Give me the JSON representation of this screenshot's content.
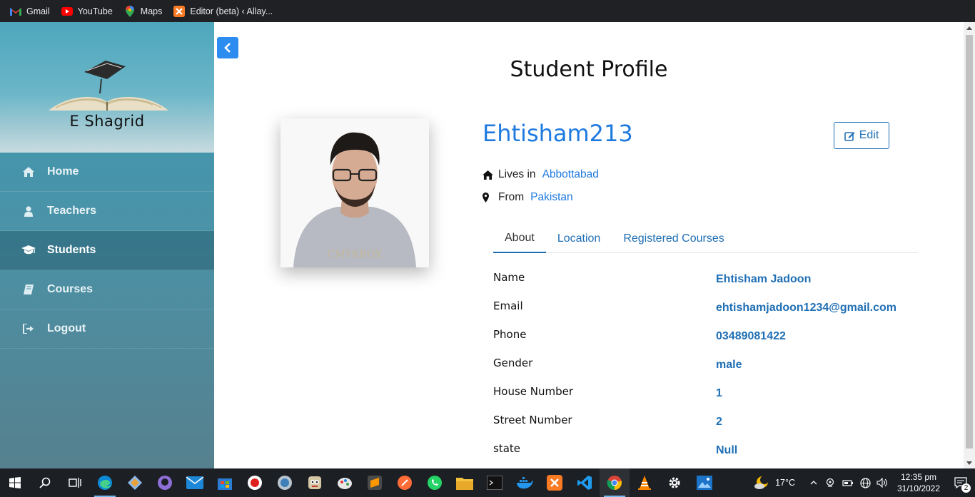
{
  "bookmarks": [
    {
      "label": "Gmail",
      "icon": "gmail-icon"
    },
    {
      "label": "YouTube",
      "icon": "youtube-icon"
    },
    {
      "label": "Maps",
      "icon": "maps-icon"
    },
    {
      "label": "Editor (beta) ‹ Allay...",
      "icon": "xampp-icon"
    }
  ],
  "sidebar": {
    "brand": "E Shagrid",
    "items": [
      {
        "label": "Home",
        "icon": "home-icon"
      },
      {
        "label": "Teachers",
        "icon": "user-icon"
      },
      {
        "label": "Students",
        "icon": "graduation-cap-icon",
        "active": true
      },
      {
        "label": "Courses",
        "icon": "book-icon"
      },
      {
        "label": "Logout",
        "icon": "sign-out-icon"
      }
    ]
  },
  "main": {
    "title": "Student Profile",
    "username": "Ehtisham213",
    "edit_label": "Edit",
    "lives_in_label": "Lives in",
    "lives_in_value": "Abbottabad",
    "from_label": "From",
    "from_value": "Pakistan",
    "tabs": [
      {
        "label": "About",
        "active": true
      },
      {
        "label": "Location"
      },
      {
        "label": "Registered Courses"
      }
    ],
    "about": [
      {
        "label": "Name",
        "value": "Ehtisham Jadoon"
      },
      {
        "label": "Email",
        "value": "ehtishamjadoon1234@gmail.com"
      },
      {
        "label": "Phone",
        "value": "03489081422"
      },
      {
        "label": "Gender",
        "value": "male"
      },
      {
        "label": "House Number",
        "value": "1"
      },
      {
        "label": "Street Number",
        "value": "2"
      },
      {
        "label": "state",
        "value": "Null"
      }
    ]
  },
  "taskbar": {
    "weather": "17°C",
    "time": "12:35 pm",
    "date": "31/10/2022",
    "notifications": "2"
  },
  "colors": {
    "accent": "#1f7ae0",
    "link": "#1f6fb5",
    "sidebar": "#4a93a8",
    "back_button": "#2d8cf0"
  }
}
